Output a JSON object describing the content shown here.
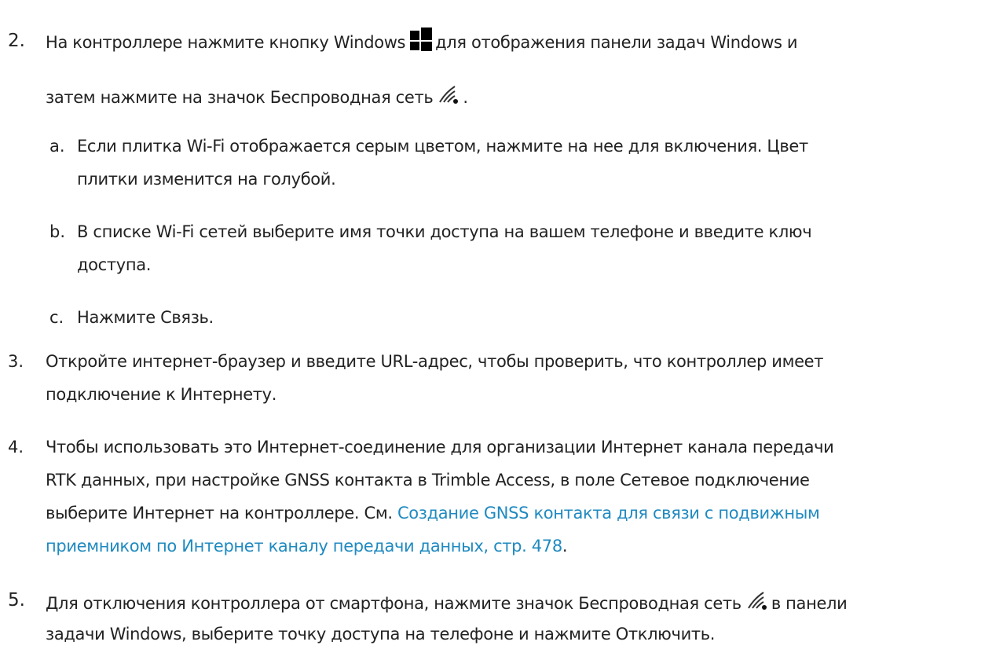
{
  "step2": {
    "number": "2.",
    "line1_before_icon": "На контроллере нажмите кнопку Windows",
    "line1_after_icon": "для отображения панели задач Windows и",
    "line2_before_icon": "затем нажмите на значок Беспроводная сеть",
    "line2_after_icon": ".",
    "substeps": [
      {
        "marker": "a.",
        "lines": [
          "Если плитка Wi-Fi отображается серым цветом, нажмите на нее для включения. Цвет",
          "плитки изменится на голубой."
        ]
      },
      {
        "marker": "b.",
        "lines": [
          "В списке Wi-Fi сетей выберите имя точки доступа на вашем телефоне и введите ключ",
          "доступа."
        ]
      },
      {
        "marker": "c.",
        "lines": [
          "Нажмите Связь."
        ]
      }
    ]
  },
  "step3": {
    "number": "3.",
    "lines": [
      "Откройте интернет-браузер и введите URL-адрес, чтобы проверить, что контроллер имеет",
      "подключение к Интернету."
    ]
  },
  "step4": {
    "number": "4.",
    "lines": [
      "Чтобы использовать это Интернет-соединение для организации Интернет канала передачи",
      "RTK данных, при настройке GNSS контакта в Trimble Access, в поле Сетевое подключение"
    ],
    "line3_before_link": "выберите Интернет на контроллере. См. ",
    "link_line1": "Создание GNSS контакта для связи с подвижным",
    "link_line2": "приемником по Интернет каналу передачи данных, стр. 478",
    "line4_after_link": "."
  },
  "step5": {
    "number": "5.",
    "line1_before_icon": "Для отключения контроллера от смартфона, нажмите значок Беспроводная сеть",
    "line1_after_icon": "в панели",
    "line2": "задачи Windows, выберите точку доступа на телефоне и нажмите Отключить."
  },
  "icons": {
    "windows": "windows-logo-icon",
    "wireless": "wireless-network-icon"
  },
  "colors": {
    "text": "#222222",
    "link": "#1f8ac0"
  }
}
